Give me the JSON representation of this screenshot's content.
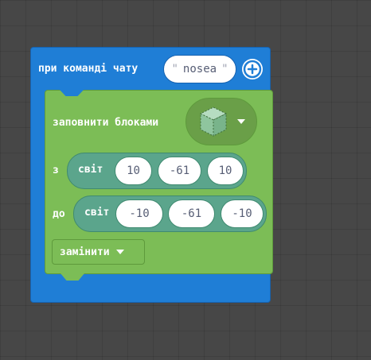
{
  "event_block": {
    "label": "при команді чату",
    "command_value": "nosea",
    "color": "#1F7ED6"
  },
  "fill_block": {
    "label": "заповнити блоками",
    "block_icon": "grass-cube-icon",
    "color": "#7CBD56",
    "from": {
      "label": "з",
      "world_label": "світ",
      "values": [
        "10",
        "-61",
        "10"
      ]
    },
    "to": {
      "label": "до",
      "world_label": "світ",
      "values": [
        "-10",
        "-61",
        "-10"
      ]
    },
    "mode": "замінити"
  }
}
